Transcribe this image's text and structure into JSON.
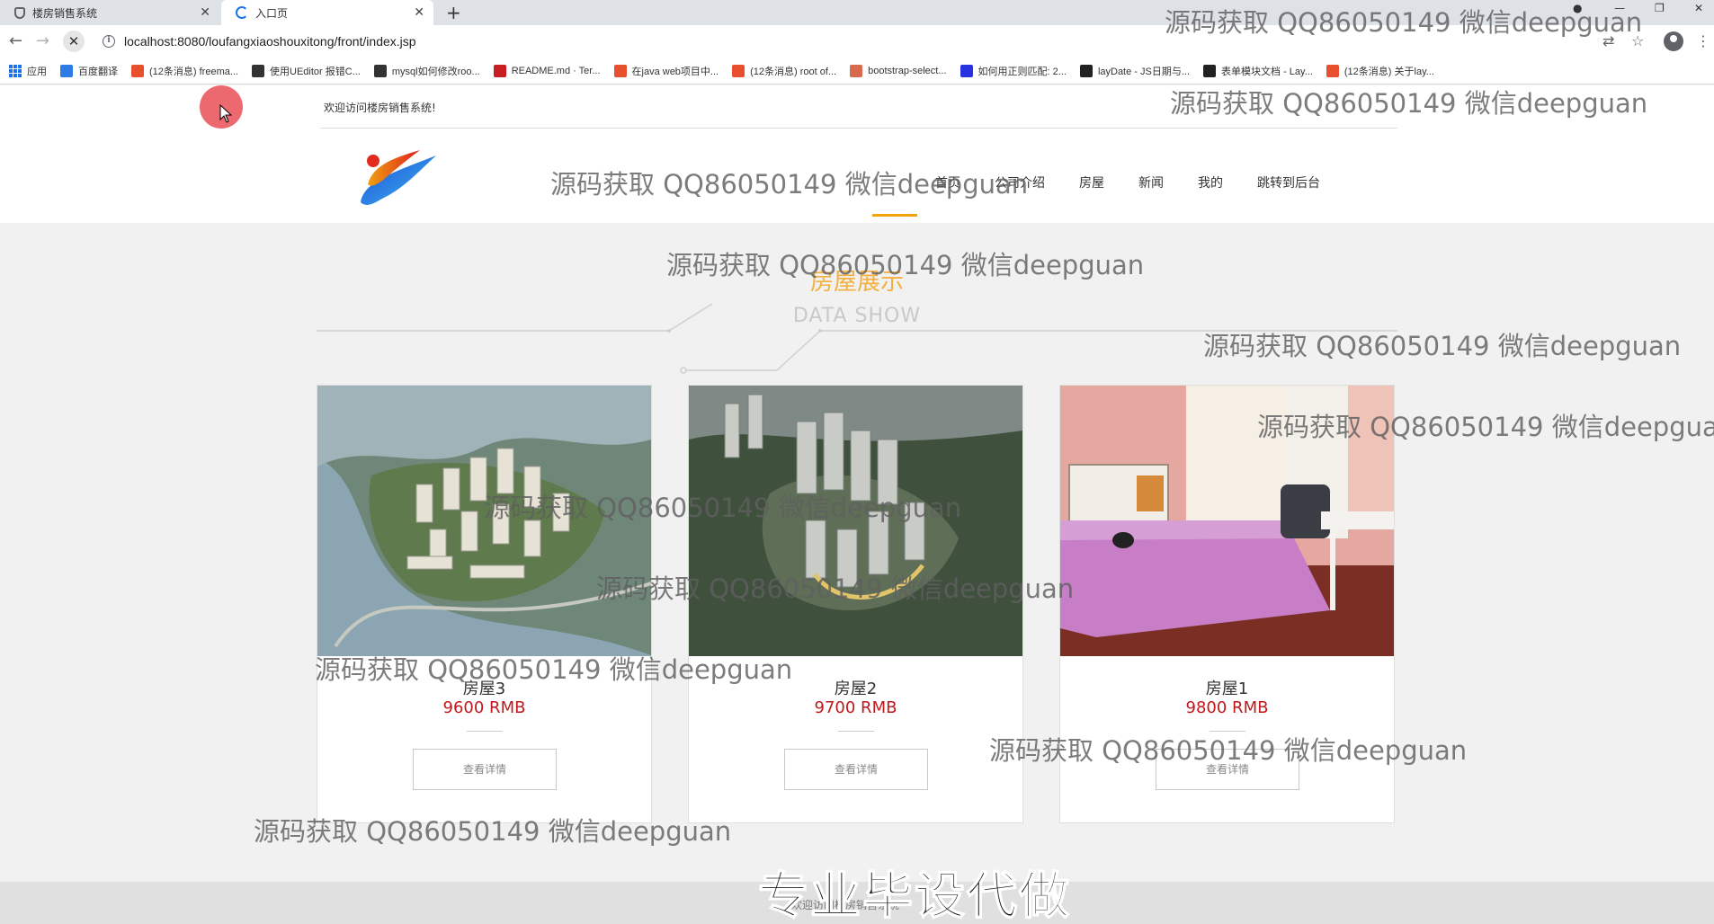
{
  "browser": {
    "tabs": [
      {
        "title": "楼房销售系统",
        "icon": "shield-icon",
        "active": false
      },
      {
        "title": "入口页",
        "icon": "loading-spinner-icon",
        "active": true
      }
    ],
    "tab_close_glyph": "✕",
    "new_tab_glyph": "+",
    "url": "localhost:8080/loufangxiaoshouxitong/front/index.jsp",
    "bookmarks": [
      {
        "label": "应用",
        "icon": "apps-icon",
        "color": "#1a73e8"
      },
      {
        "label": "百度翻译",
        "icon": "translate-icon",
        "color": "#2d7be5"
      },
      {
        "label": "(12条消息) freema...",
        "icon": "csdn-icon",
        "color": "#e8502d"
      },
      {
        "label": "使用UEditor 报错C...",
        "icon": "ueditor-icon",
        "color": "#333333"
      },
      {
        "label": "mysql如何修改roo...",
        "icon": "ueditor-icon",
        "color": "#333333"
      },
      {
        "label": "README.md · Ter...",
        "icon": "gitee-icon",
        "color": "#c71d23"
      },
      {
        "label": "在java web项目中...",
        "icon": "csdn-icon",
        "color": "#e8502d"
      },
      {
        "label": "(12条消息) root of...",
        "icon": "csdn-icon",
        "color": "#e8502d"
      },
      {
        "label": "bootstrap-select...",
        "icon": "bootstrap-icon",
        "color": "#d86a4e"
      },
      {
        "label": "如何用正则匹配: 2...",
        "icon": "baidu-icon",
        "color": "#2932e1"
      },
      {
        "label": "layDate - JS日期与...",
        "icon": "layui-icon",
        "color": "#222222"
      },
      {
        "label": "表单模块文档 - Lay...",
        "icon": "layui-icon",
        "color": "#222222"
      },
      {
        "label": "(12条消息) 关于lay...",
        "icon": "csdn-icon",
        "color": "#e8502d"
      }
    ]
  },
  "site": {
    "welcome": "欢迎访问楼房销售系统!",
    "nav": [
      "首页",
      "公司介绍",
      "房屋",
      "新闻",
      "我的",
      "跳转到后台"
    ],
    "active_nav": "首页",
    "accent_color": "#f0a30a",
    "section_title": "房屋展示",
    "section_subtitle": "DATA SHOW",
    "houses": [
      {
        "name": "房屋3",
        "price": "9600 RMB",
        "detail_label": "查看详情",
        "photo": "aerial-riverside-complex"
      },
      {
        "name": "房屋2",
        "price": "9700 RMB",
        "detail_label": "查看详情",
        "photo": "aerial-tower-complex"
      },
      {
        "name": "房屋1",
        "price": "9800 RMB",
        "detail_label": "查看详情",
        "photo": "bedroom-interior"
      }
    ],
    "price_color": "#c0181c",
    "footer_text": "欢迎访问楼房销售系统"
  },
  "overlay": {
    "caption": "专业毕设代做",
    "watermark": "源码获取 QQ86050149 微信deepguan"
  }
}
